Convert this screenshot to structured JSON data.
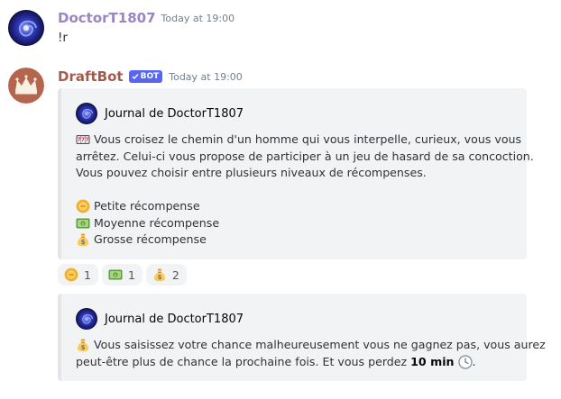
{
  "messages": [
    {
      "username": "DoctorT1807",
      "timestamp": "Today at 19:00",
      "content": "!r"
    },
    {
      "username": "DraftBot",
      "bot_tag": "BOT",
      "timestamp": "Today at 19:00",
      "embed": {
        "author": "Journal de DoctorT1807",
        "lines": [
          "Vous croisez le chemin d'un homme qui vous interpelle, curieux, vous vous",
          "arrêtez. Celui-ci vous propose de participer à un jeu de hasard de sa concoction.",
          "Vous pouvez choisir entre plusieurs niveaux de récompenses."
        ],
        "options": [
          {
            "icon": "coin-icon",
            "label": "Petite récompense"
          },
          {
            "icon": "dollar-banknote-icon",
            "label": "Moyenne récompense"
          },
          {
            "icon": "money-bag-icon",
            "label": "Grosse récompense"
          }
        ]
      },
      "reactions": [
        {
          "icon": "coin-icon",
          "count": "1"
        },
        {
          "icon": "dollar-banknote-icon",
          "count": "1"
        },
        {
          "icon": "money-bag-icon",
          "count": "2"
        }
      ]
    },
    {
      "embed": {
        "author": "Journal de DoctorT1807",
        "result_line1": "Vous saisissez votre chance malheureusement vous ne gagnez pas, vous aurez",
        "result_line2_prefix": "peut-être plus de chance la prochaine fois. Et vous perdez",
        "result_bold": "10 min",
        "result_suffix": "."
      }
    }
  ],
  "colors": {
    "user1": "#9b84c1",
    "bot": "#a35b4d",
    "bot_tag_bg": "#5865f2",
    "embed_bg": "#f2f3f5",
    "embed_border": "#e3e5e8"
  }
}
